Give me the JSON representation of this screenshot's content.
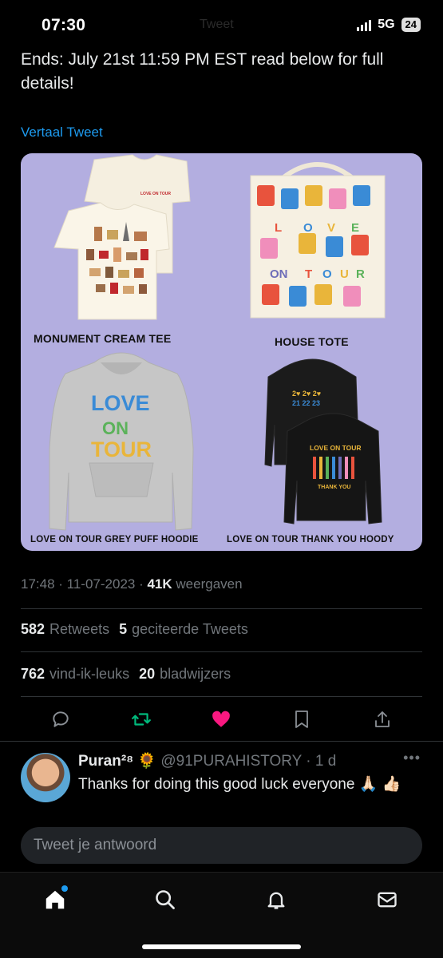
{
  "status_bar": {
    "time": "07:30",
    "network": "5G",
    "battery": "24"
  },
  "header_ghost": "Tweet",
  "tweet": {
    "text": "Ends: July 21st 11:59 PM EST read below for full details!",
    "translate_label": "Vertaal Tweet",
    "products": [
      {
        "name": "MONUMENT CREAM TEE"
      },
      {
        "name": "HOUSE TOTE"
      },
      {
        "name": "LOVE ON TOUR GREY PUFF HOODIE"
      },
      {
        "name": "LOVE ON TOUR THANK YOU HOODY"
      }
    ],
    "product_prints": {
      "tee_chest": "LOVE ON TOUR",
      "tote_letters": [
        "L",
        "O",
        "V",
        "E",
        "ON",
        "T",
        "O",
        "U",
        "R"
      ],
      "grey_hoodie_print": [
        "LOVE",
        "ON",
        "TOUR"
      ],
      "black_hoodie_front": "2♥ 2♥ 2♥",
      "black_hoodie_front_years": "21 22 23",
      "black_hoodie_back": "LOVE ON TOUR",
      "black_hoodie_back_bottom": "THANK YOU"
    },
    "time": "17:48",
    "date": "11-07-2023",
    "views_count": "41K",
    "views_label": "weergaven",
    "retweets_count": "582",
    "retweets_label": "Retweets",
    "quotes_count": "5",
    "quotes_label": "geciteerde Tweets",
    "likes_count": "762",
    "likes_label": "vind-ik-leuks",
    "bookmarks_count": "20",
    "bookmarks_label": "bladwijzers"
  },
  "actions": [
    "reply-icon",
    "retweet-icon",
    "like-icon",
    "bookmark-icon",
    "share-icon"
  ],
  "reply": {
    "name": "Puran²⁸ 🌻",
    "handle": "@91PURAHISTORY",
    "time": "1 d",
    "text": "Thanks for doing this good luck everyone 🙏🏻 👍🏻"
  },
  "composer": {
    "placeholder": "Tweet je antwoord"
  },
  "nav": [
    "home-icon",
    "search-icon",
    "notifications-icon",
    "messages-icon"
  ],
  "colors": {
    "accent": "#1d9bf0",
    "like": "#f91880",
    "retweet": "#00ba7c",
    "media_bg": "#b3aee0"
  }
}
